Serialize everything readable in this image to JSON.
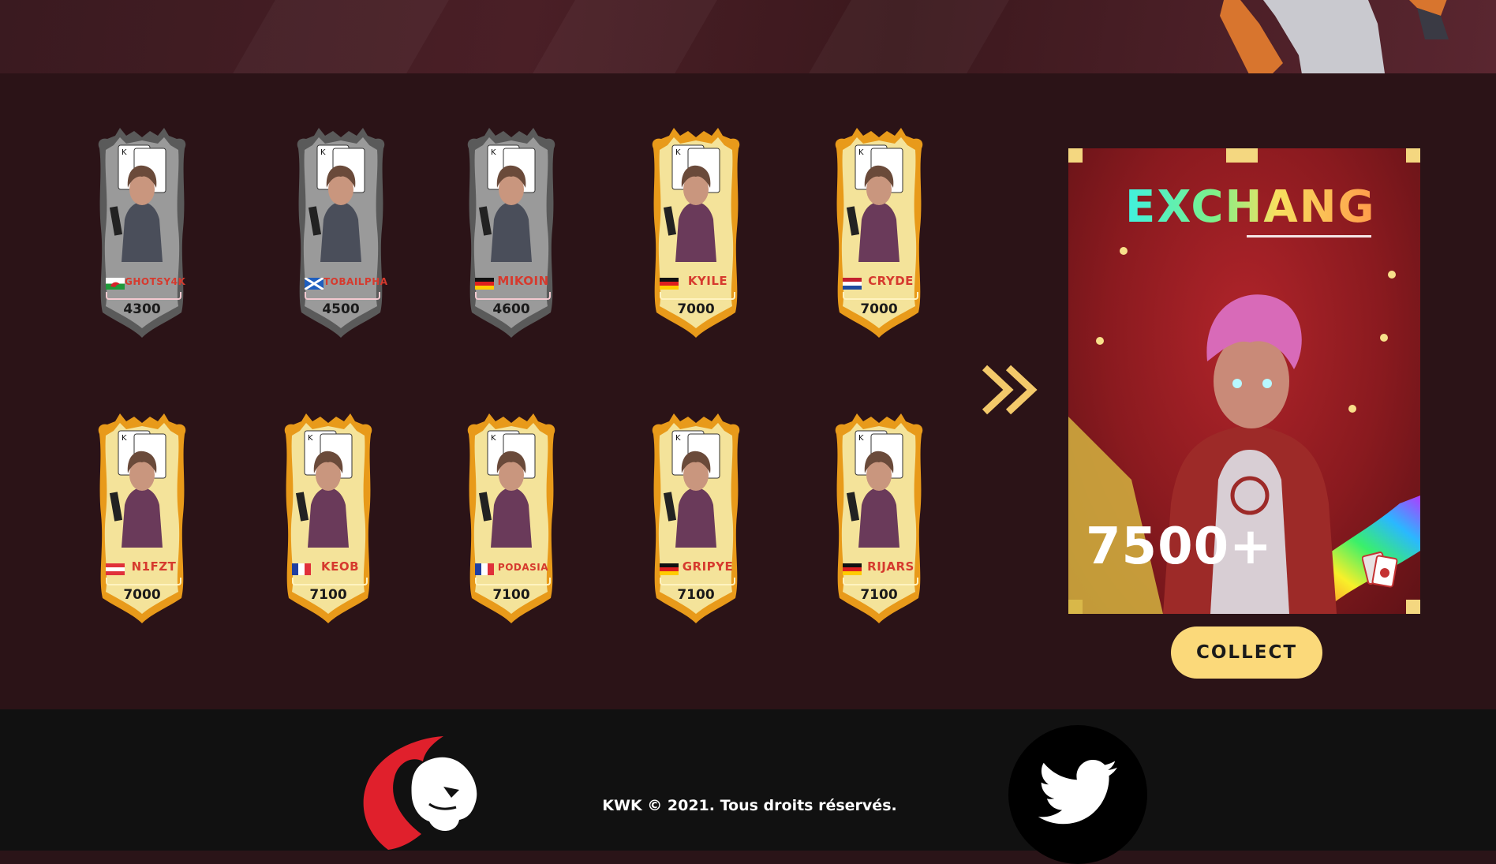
{
  "cards_row1": [
    {
      "name": "GHOTSY4K",
      "price": "4300",
      "tier": "silver",
      "flag": "wales",
      "icon": "wales-flag-icon"
    },
    {
      "name": "TOBAILPHA",
      "price": "4500",
      "tier": "silver",
      "flag": "scotland",
      "icon": "scotland-flag-icon"
    },
    {
      "name": "MIKOIN",
      "price": "4600",
      "tier": "silver",
      "flag": "germany",
      "icon": "germany-flag-icon"
    },
    {
      "name": "KYILE",
      "price": "7000",
      "tier": "gold",
      "flag": "germany",
      "icon": "germany-flag-icon"
    },
    {
      "name": "CRYDE",
      "price": "7000",
      "tier": "gold",
      "flag": "netherlands",
      "icon": "netherlands-flag-icon"
    }
  ],
  "cards_row2": [
    {
      "name": "N1FZT",
      "price": "7000",
      "tier": "gold",
      "flag": "austria",
      "icon": "austria-flag-icon"
    },
    {
      "name": "KEOB",
      "price": "7100",
      "tier": "gold",
      "flag": "france",
      "icon": "france-flag-icon"
    },
    {
      "name": "PODASIA",
      "price": "7100",
      "tier": "gold",
      "flag": "france",
      "icon": "france-flag-icon"
    },
    {
      "name": "GRIPYE",
      "price": "7100",
      "tier": "gold",
      "flag": "germany",
      "icon": "germany-flag-icon"
    },
    {
      "name": "RIJARS",
      "price": "7100",
      "tier": "gold",
      "flag": "germany",
      "icon": "germany-flag-icon"
    }
  ],
  "exchange": {
    "title": "EXCHANGE",
    "amount": "7500+",
    "button_label": "COLLECT"
  },
  "footer": {
    "copyright": "KWK © 2021. Tous droits réservés.",
    "logo_icon": "lion-logo-icon",
    "social_icon": "twitter-icon"
  },
  "colors": {
    "background": "#2b1317",
    "gold": "#f3d37a",
    "silver": "#8a8a8a",
    "name_red": "#d63a2e",
    "button": "#fbd97a",
    "footer": "#111111"
  }
}
